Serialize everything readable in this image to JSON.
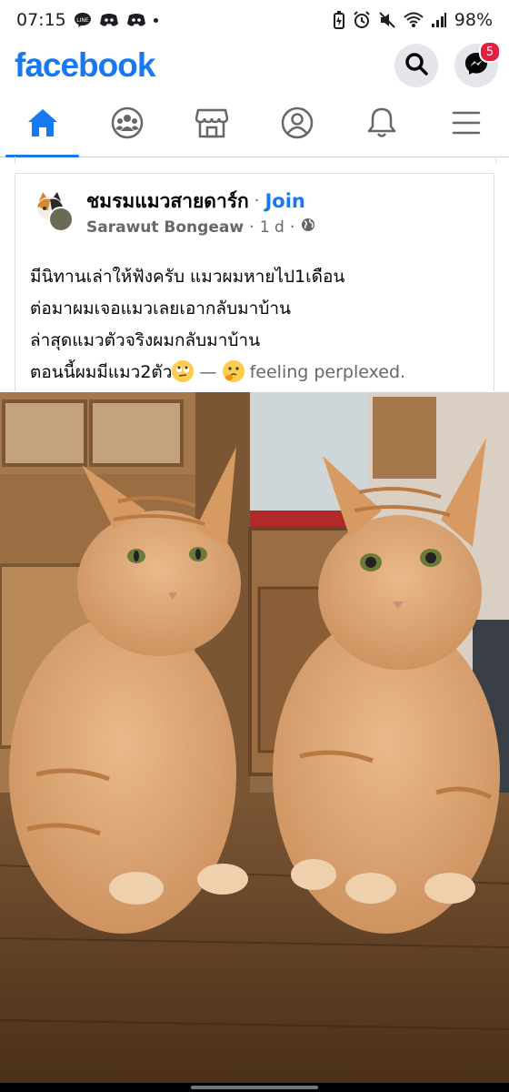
{
  "status_bar": {
    "time": "07:15",
    "left_icons": [
      "line-app-icon",
      "discord-icon",
      "discord-icon",
      "notification-dot-icon"
    ],
    "right_icons": [
      "battery-saver-icon",
      "alarm-icon",
      "mute-icon",
      "wifi-icon",
      "signal-icon"
    ],
    "battery": "98%"
  },
  "header": {
    "logo": "facebook",
    "messenger_badge": "5"
  },
  "tabs": [
    {
      "icon": "home-icon",
      "active": true
    },
    {
      "icon": "groups-icon",
      "active": false
    },
    {
      "icon": "marketplace-icon",
      "active": false
    },
    {
      "icon": "profile-icon",
      "active": false
    },
    {
      "icon": "bell-icon",
      "active": false
    },
    {
      "icon": "menu-icon",
      "active": false
    }
  ],
  "post": {
    "group_name": "ชมรมแมวสายดาร์ก",
    "separator": "·",
    "join_label": "Join",
    "author": "Sarawut Bongeaw",
    "time": "1 d",
    "privacy_icon": "globe-icon",
    "text_lines": [
      "มีนิทานเล่าให้ฟังครับ แมวผมหายไป1เดือน",
      "ต่อมาผมเจอแมวเลยเอากลับมาบ้าน",
      "ล่าสุดแมวตัวจริงผมกลับมาบ้าน"
    ],
    "last_line_text": "ตอนนี้ผมมีแมว2ตัว",
    "feeling_dash": "—",
    "feeling_text": "feeling perplexed."
  },
  "photo": {
    "description_icon": "two-orange-cats-photo"
  },
  "colors": {
    "brand": "#1877f2",
    "badge": "#e41e3f",
    "secondary_text": "#65676b"
  }
}
